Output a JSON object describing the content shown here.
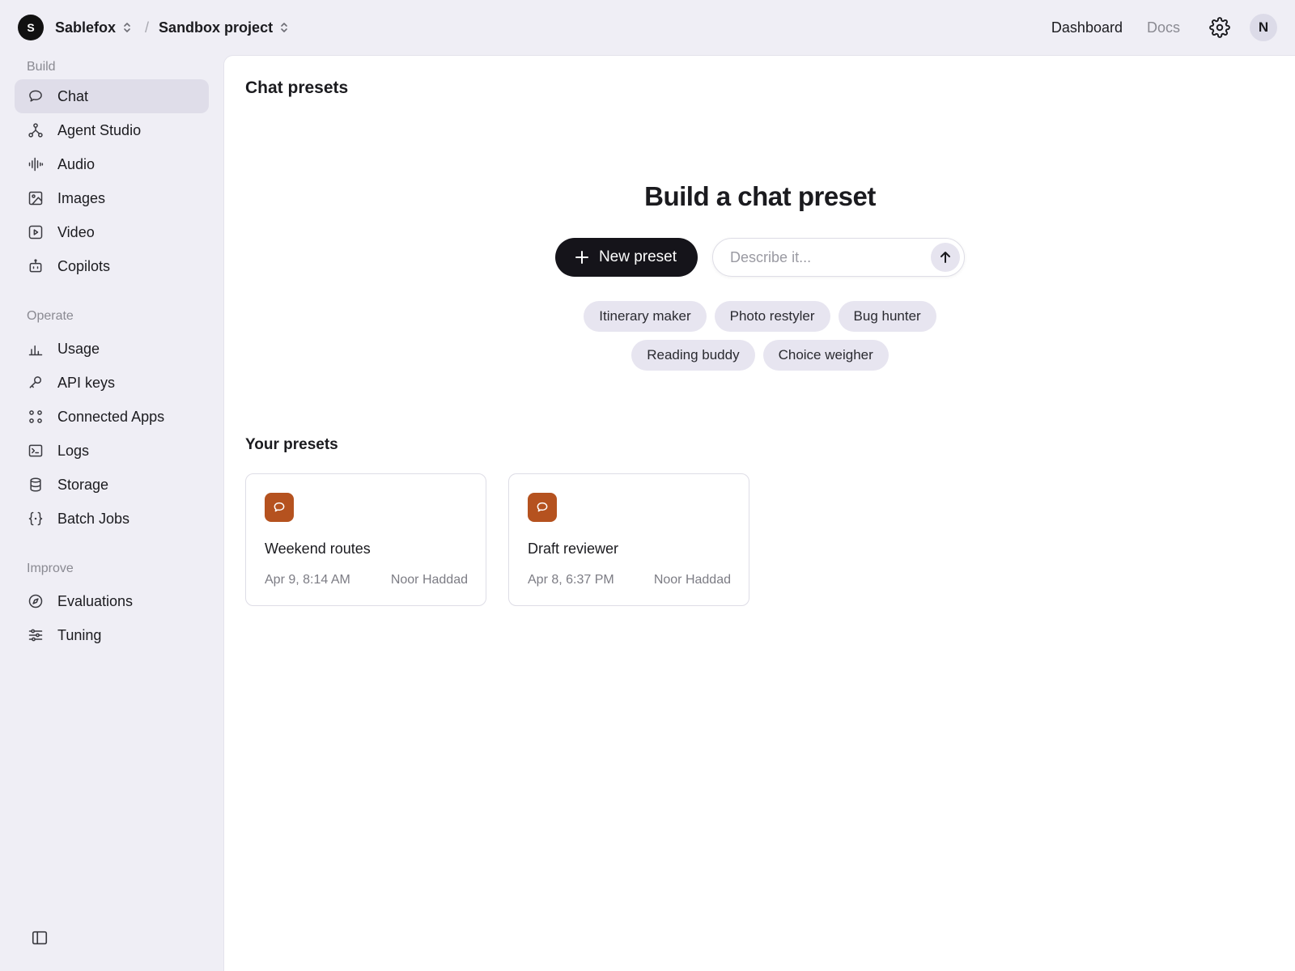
{
  "topbar": {
    "org_initial": "S",
    "org_name": "Sablefox",
    "project_name": "Sandbox project",
    "separator": "/",
    "links": [
      "Dashboard",
      "Docs"
    ],
    "user_initial": "N"
  },
  "sidebar": {
    "sections": [
      {
        "label": "Build",
        "items": [
          {
            "label": "Chat",
            "icon": "chat-bubble-icon",
            "active": true
          },
          {
            "label": "Agent Studio",
            "icon": "agent-nodes-icon"
          },
          {
            "label": "Audio",
            "icon": "waveform-icon"
          },
          {
            "label": "Images",
            "icon": "image-icon"
          },
          {
            "label": "Video",
            "icon": "play-square-icon"
          },
          {
            "label": "Copilots",
            "icon": "robot-icon"
          }
        ]
      },
      {
        "label": "Operate",
        "items": [
          {
            "label": "Usage",
            "icon": "bar-chart-icon"
          },
          {
            "label": "API keys",
            "icon": "key-icon"
          },
          {
            "label": "Connected Apps",
            "icon": "apps-grid-icon"
          },
          {
            "label": "Logs",
            "icon": "terminal-icon"
          },
          {
            "label": "Storage",
            "icon": "database-icon"
          },
          {
            "label": "Batch Jobs",
            "icon": "braces-icon"
          }
        ]
      },
      {
        "label": "Improve",
        "items": [
          {
            "label": "Evaluations",
            "icon": "compass-icon"
          },
          {
            "label": "Tuning",
            "icon": "sliders-icon"
          }
        ]
      }
    ]
  },
  "main": {
    "page_title": "Chat presets",
    "hero_title": "Build a chat preset",
    "new_button": "New preset",
    "describe_placeholder": "Describe it...",
    "suggestions_row1": [
      "Itinerary maker",
      "Photo restyler",
      "Bug hunter"
    ],
    "suggestions_row2": [
      "Reading buddy",
      "Choice weigher"
    ],
    "presets_title": "Your presets",
    "presets": [
      {
        "name": "Weekend routes",
        "date": "Apr 9, 8:14 AM",
        "author": "Noor Haddad"
      },
      {
        "name": "Draft reviewer",
        "date": "Apr 8, 6:37 PM",
        "author": "Noor Haddad"
      }
    ]
  },
  "colors": {
    "accent_dark": "#15141a",
    "preset_badge": "#b5521f",
    "sidebar_active": "#dfdde9",
    "background": "#efeef5"
  }
}
